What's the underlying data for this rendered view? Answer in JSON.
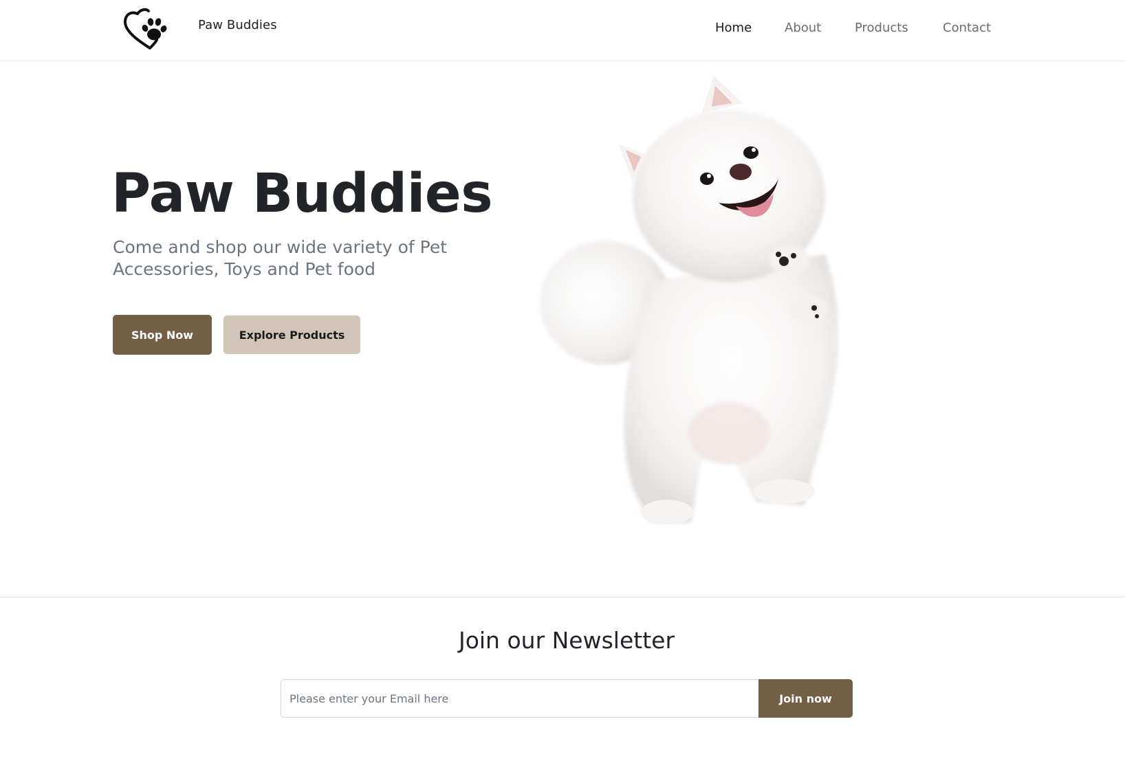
{
  "colors": {
    "brand_brown": "#735f45",
    "brand_beige": "#d0c5b7",
    "text_dark": "#212529",
    "text_muted": "#6c757d"
  },
  "navbar": {
    "logo_icon": "heart-paw-icon",
    "brand": "Paw Buddies",
    "links": [
      {
        "label": "Home",
        "active": true
      },
      {
        "label": "About",
        "active": false
      },
      {
        "label": "Products",
        "active": false
      },
      {
        "label": "Contact",
        "active": false
      }
    ]
  },
  "hero": {
    "title": "Paw Buddies",
    "subtitle": "Come and shop our wide variety of Pet Accessories, Toys and Pet food",
    "primary_button": "Shop Now",
    "secondary_button": "Explore Products",
    "image_subject": "white fluffy dog standing on hind legs"
  },
  "newsletter": {
    "title": "Join our Newsletter",
    "email_value": "",
    "email_placeholder": "Please enter your Email here",
    "button": "Join now"
  }
}
